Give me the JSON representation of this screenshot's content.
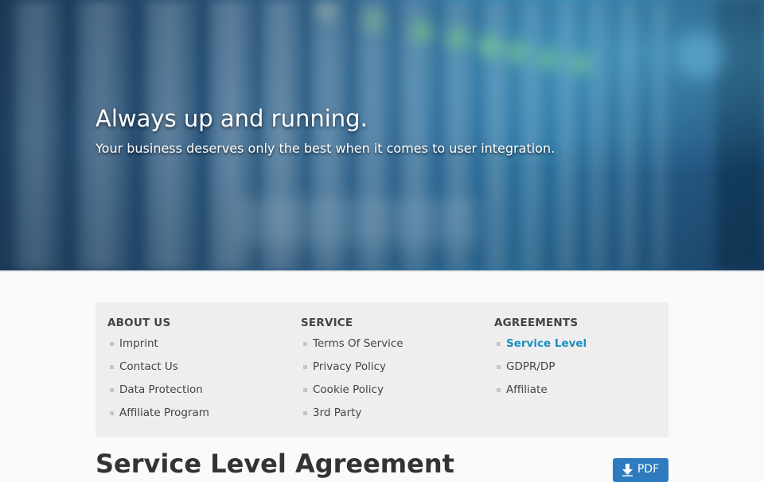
{
  "hero": {
    "title": "Always up and running.",
    "subtitle": "Your business deserves only the best when it comes to user integration."
  },
  "nav": {
    "columns": [
      {
        "heading": "ABOUT US",
        "items": [
          "Imprint",
          "Contact Us",
          "Data Protection",
          "Affiliate Program"
        ]
      },
      {
        "heading": "SERVICE",
        "items": [
          "Terms Of Service",
          "Privacy Policy",
          "Cookie Policy",
          "3rd Party"
        ]
      },
      {
        "heading": "AGREEMENTS",
        "items": [
          "Service Level",
          "GDPR/DP",
          "Affiliate"
        ],
        "active_item": "Service Level"
      }
    ]
  },
  "page": {
    "title": "Service Level Agreement",
    "pdf_label": "PDF",
    "pdf_icon": "download-arrow-icon"
  },
  "colors": {
    "accent": "#1a8ec2",
    "button": "#2f7bbf",
    "panel": "#eeeeee"
  }
}
